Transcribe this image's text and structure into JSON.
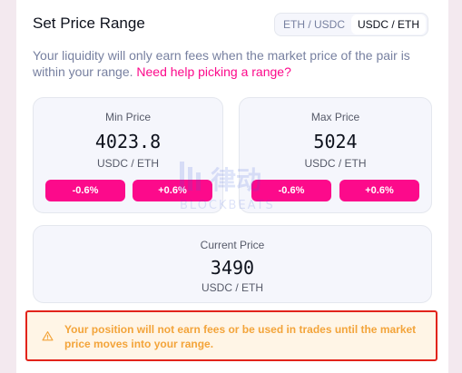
{
  "header": {
    "title": "Set Price Range",
    "toggle": [
      {
        "label": "ETH / USDC",
        "active": false
      },
      {
        "label": "USDC / ETH",
        "active": true
      }
    ]
  },
  "description": {
    "text": "Your liquidity will only earn fees when the market price of the pair is within your range.",
    "link": "Need help picking a range?"
  },
  "min_price": {
    "label": "Min Price",
    "value": "4023.8",
    "unit": "USDC / ETH",
    "decrease": "-0.6%",
    "increase": "+0.6%"
  },
  "max_price": {
    "label": "Max Price",
    "value": "5024",
    "unit": "USDC / ETH",
    "decrease": "-0.6%",
    "increase": "+0.6%"
  },
  "current_price": {
    "label": "Current Price",
    "value": "3490",
    "unit": "USDC / ETH"
  },
  "warning": {
    "text": "Your position will not earn fees or be used in trades until the market price moves into your range."
  },
  "watermark": {
    "text": "律动 BLOCKBEATS"
  },
  "colors": {
    "accent": "#fc0a8b",
    "warning_text": "#f3a43a",
    "warning_bg": "#fff5e6",
    "highlight_border": "#e2231a"
  }
}
